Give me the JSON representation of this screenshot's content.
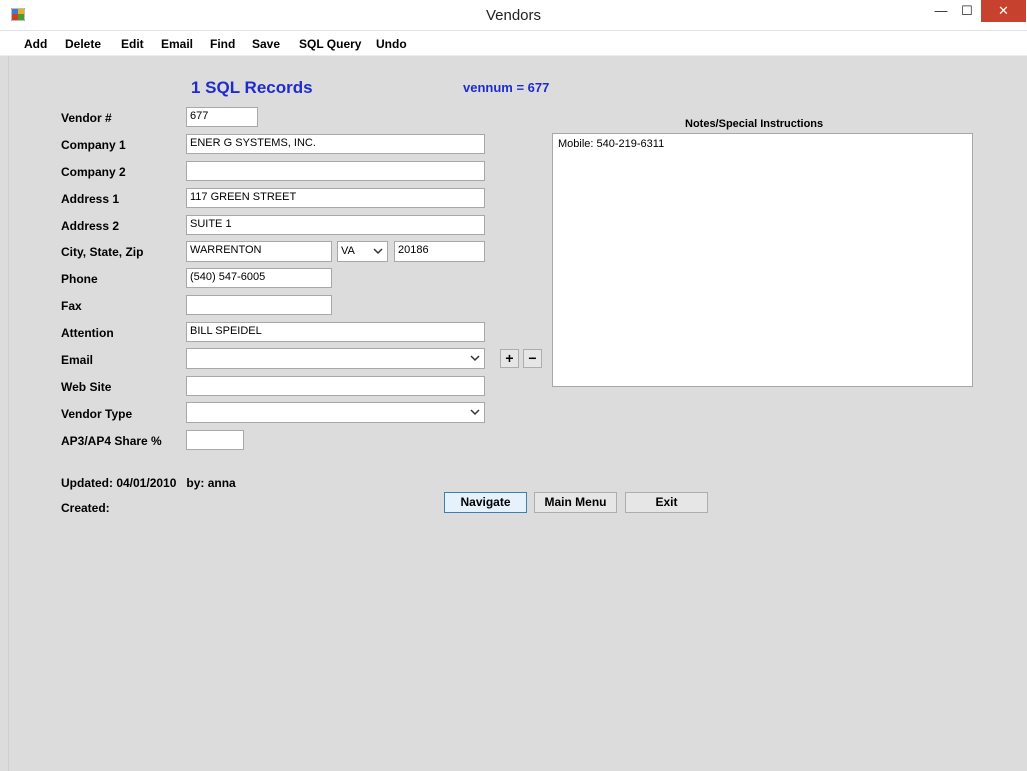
{
  "window": {
    "title": "Vendors",
    "minimize": "—",
    "maximize": "☐",
    "close": "✕"
  },
  "menu": [
    "Add",
    "Delete",
    "Edit",
    "Email",
    "Find",
    "Save",
    "SQL Query",
    "Undo"
  ],
  "header": {
    "records": "1 SQL Records",
    "vennum": "vennum = 677"
  },
  "form": {
    "vendor_no": {
      "label": "Vendor #",
      "value": "677"
    },
    "company1": {
      "label": "Company 1",
      "value": "ENER G SYSTEMS, INC."
    },
    "company2": {
      "label": "Company 2",
      "value": ""
    },
    "address1": {
      "label": "Address 1",
      "value": "117 GREEN STREET"
    },
    "address2": {
      "label": "Address 2",
      "value": "SUITE 1"
    },
    "csz": {
      "label": "City, State, Zip",
      "city": "WARRENTON",
      "state": "VA",
      "zip": "20186"
    },
    "phone": {
      "label": "Phone",
      "value": "(540) 547-6005"
    },
    "fax": {
      "label": "Fax",
      "value": ""
    },
    "attention": {
      "label": "Attention",
      "value": "BILL SPEIDEL"
    },
    "email": {
      "label": "Email",
      "value": ""
    },
    "website": {
      "label": "Web Site",
      "value": ""
    },
    "vendor_type": {
      "label": "Vendor Type",
      "value": ""
    },
    "share": {
      "label": "AP3/AP4 Share %",
      "value": ""
    }
  },
  "email_buttons": {
    "add": "+",
    "remove": "−"
  },
  "notes": {
    "label": "Notes/Special Instructions",
    "text": "Mobile:  540-219-6311"
  },
  "footer": {
    "updated": "Updated: 04/01/2010   by: anna",
    "created": "Created:"
  },
  "buttons": {
    "navigate": "Navigate",
    "main_menu": "Main Menu",
    "exit": "Exit"
  }
}
